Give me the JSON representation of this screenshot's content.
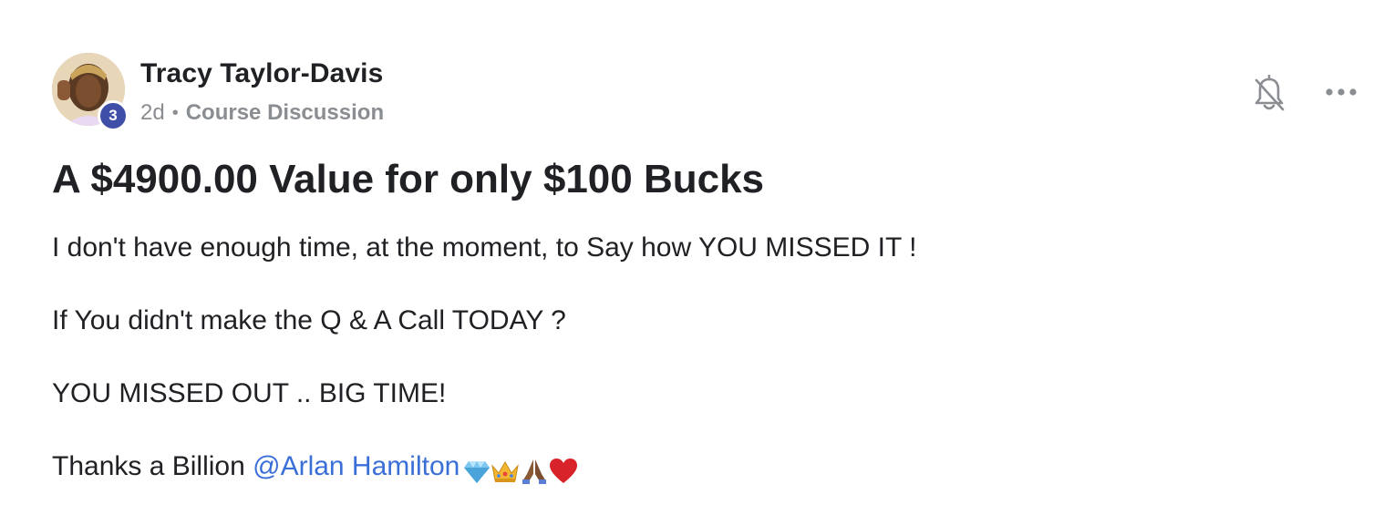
{
  "post": {
    "author": {
      "name": "Tracy Taylor-Davis",
      "level": "3"
    },
    "meta": {
      "time": "2d",
      "separator": "•",
      "category": "Course Discussion"
    },
    "title": "A $4900.00 Value for only $100 Bucks",
    "paragraphs": [
      "I don't have enough time, at the moment, to Say how YOU MISSED IT !",
      "If You didn't make the Q & A Call TODAY ?",
      "YOU MISSED OUT .. BIG TIME!"
    ],
    "closing": {
      "text": "Thanks a Billion ",
      "mention": "@Arlan Hamilton",
      "emojis": [
        "gem-icon",
        "crown-icon",
        "folded-hands-icon",
        "red-heart-icon"
      ]
    },
    "actions": {
      "notify_icon": "bell-off-icon",
      "more_icon": "more-horizontal-icon"
    }
  },
  "colors": {
    "mention": "#3b6fd8",
    "badge": "#3f4fa8",
    "meta": "#8a8d91",
    "text": "#202124"
  }
}
